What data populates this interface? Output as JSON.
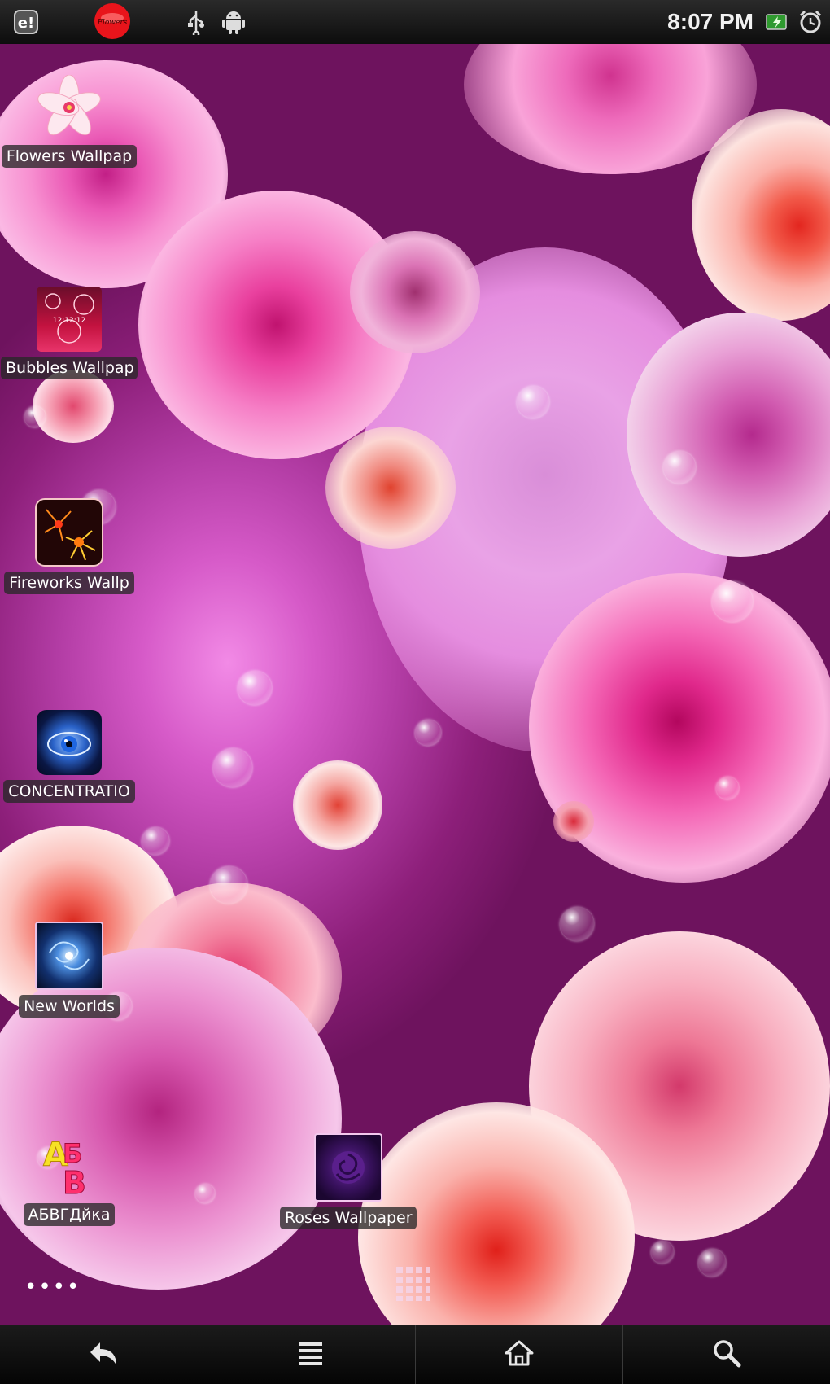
{
  "status_bar": {
    "time": "8:07 PM",
    "icons": [
      "notification-app-icon",
      "flower-notification-icon",
      "usb-icon",
      "android-debug-icon",
      "battery-charging-icon",
      "alarm-clock-icon"
    ]
  },
  "desktop": {
    "apps": [
      {
        "name": "flowers-wallpaper-app",
        "label": "Flowers Wallpap",
        "icon": "flower-icon"
      },
      {
        "name": "bubbles-wallpaper-app",
        "label": "Bubbles Wallpap",
        "icon": "bubbles-icon"
      },
      {
        "name": "fireworks-wallpaper-app",
        "label": "Fireworks Wallp",
        "icon": "fireworks-icon"
      },
      {
        "name": "concentration-app",
        "label": "CONCENTRATIO",
        "icon": "eye-icon"
      },
      {
        "name": "new-worlds-app",
        "label": "New Worlds",
        "icon": "galaxy-icon"
      },
      {
        "name": "abvgdika-app",
        "label": "АБВГДйка",
        "icon": "letters-icon"
      },
      {
        "name": "roses-wallpaper-app",
        "label": "Roses Wallpaper",
        "icon": "rose-icon"
      }
    ],
    "page_indicator": "••••"
  },
  "nav_bar": {
    "buttons": [
      "back-icon",
      "menu-icon",
      "home-icon",
      "search-icon"
    ]
  },
  "colors": {
    "wallpaper_center": "#f28ae6",
    "wallpaper_edge": "#6e135e",
    "label_bg": "#2a2a2a",
    "status_bar": "#111111"
  }
}
